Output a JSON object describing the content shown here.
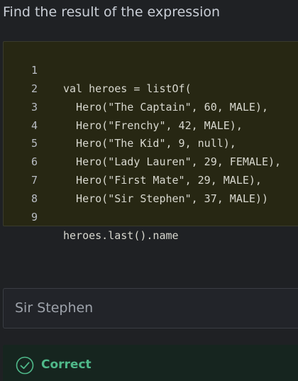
{
  "prompt": {
    "title": "Find the result of the expression"
  },
  "code": {
    "lines": [
      {
        "num": "1",
        "text": "val heroes = listOf("
      },
      {
        "num": "2",
        "text": "  Hero(\"The Captain\", 60, MALE),"
      },
      {
        "num": "3",
        "text": "  Hero(\"Frenchy\", 42, MALE),"
      },
      {
        "num": "4",
        "text": "  Hero(\"The Kid\", 9, null),"
      },
      {
        "num": "5",
        "text": "  Hero(\"Lady Lauren\", 29, FEMALE),"
      },
      {
        "num": "6",
        "text": "  Hero(\"First Mate\", 29, MALE),"
      },
      {
        "num": "7",
        "text": "  Hero(\"Sir Stephen\", 37, MALE))"
      },
      {
        "num": "8",
        "text": ""
      },
      {
        "num": "9",
        "text": "heroes.last().name"
      }
    ]
  },
  "answer": {
    "value": "Sir Stephen"
  },
  "result": {
    "label": "Correct",
    "icon": "check-circle-icon",
    "color": "#4fb98a"
  },
  "colors": {
    "background": "#1f2124",
    "code_background": "#272713",
    "success": "#4fb98a"
  }
}
